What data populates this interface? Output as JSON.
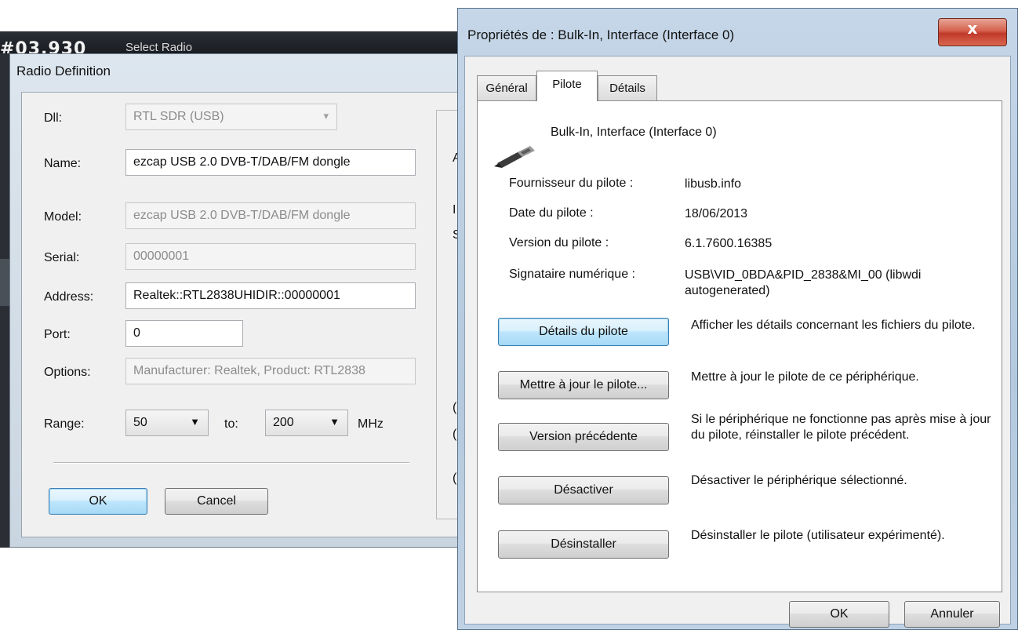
{
  "background_app": {
    "frequency_fragment": "#03.930",
    "select_radio_fragment": "Select Radio"
  },
  "radio_definition": {
    "title": "Radio Definition",
    "fields": {
      "dll": {
        "label": "Dll:",
        "value": "RTL SDR (USB)"
      },
      "name": {
        "label": "Name:",
        "value": "ezcap USB 2.0 DVB-T/DAB/FM dongle"
      },
      "model": {
        "label": "Model:",
        "value": "ezcap USB 2.0 DVB-T/DAB/FM dongle"
      },
      "serial": {
        "label": "Serial:",
        "value": "00000001"
      },
      "address": {
        "label": "Address:",
        "value": "Realtek::RTL2838UHIDIR::00000001"
      },
      "port": {
        "label": "Port:",
        "value": "0"
      },
      "options": {
        "label": "Options:",
        "value": "Manufacturer: Realtek, Product: RTL2838"
      }
    },
    "range": {
      "label": "Range:",
      "from": "50",
      "to_label": "to:",
      "to": "200",
      "unit": "MHz"
    },
    "ok_label": "OK",
    "cancel_label": "Cancel",
    "right_panel_letters": [
      "A",
      "I",
      "S",
      "(",
      "(",
      "("
    ]
  },
  "properties": {
    "title": "Propriétés de : Bulk-In, Interface (Interface 0)",
    "close_glyph": "x",
    "tabs": [
      {
        "label": "Général",
        "active": false
      },
      {
        "label": "Pilote",
        "active": true
      },
      {
        "label": "Détails",
        "active": false
      }
    ],
    "device_name": "Bulk-In, Interface (Interface 0)",
    "info": [
      {
        "key": "Fournisseur du pilote :",
        "value": "libusb.info"
      },
      {
        "key": "Date du pilote :",
        "value": "18/06/2013"
      },
      {
        "key": "Version du pilote :",
        "value": "6.1.7600.16385"
      },
      {
        "key": "Signataire numérique :",
        "value": "USB\\VID_0BDA&PID_2838&MI_00 (libwdi autogenerated)"
      }
    ],
    "actions": [
      {
        "label": "Détails du pilote",
        "description": "Afficher les détails concernant les fichiers du pilote."
      },
      {
        "label": "Mettre à jour le pilote...",
        "description": "Mettre à jour le pilote de ce périphérique."
      },
      {
        "label": "Version précédente",
        "description": "Si le périphérique ne fonctionne pas après mise à jour du pilote, réinstaller le pilote précédent."
      },
      {
        "label": "Désactiver",
        "description": "Désactiver le périphérique sélectionné."
      },
      {
        "label": "Désinstaller",
        "description": "Désinstaller le pilote (utilisateur expérimenté)."
      }
    ],
    "ok_label": "OK",
    "cancel_label": "Annuler"
  }
}
